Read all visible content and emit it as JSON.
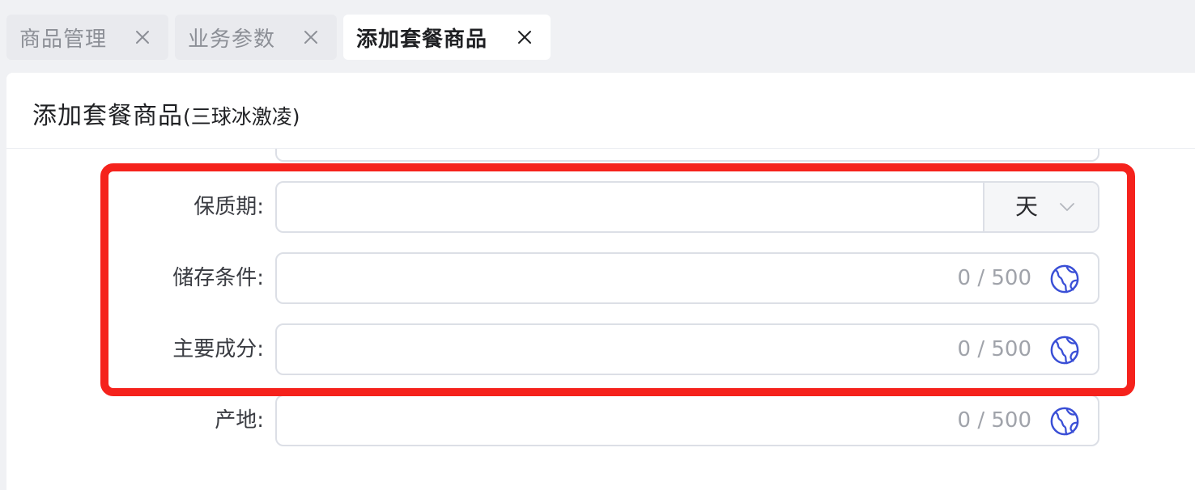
{
  "tabs": [
    {
      "label": "商品管理",
      "active": false
    },
    {
      "label": "业务参数",
      "active": false
    },
    {
      "label": "添加套餐商品",
      "active": true
    }
  ],
  "panel": {
    "title": "添加套餐商品",
    "subtitle": "(三球冰激凌)"
  },
  "form": {
    "shelf_life": {
      "label": "保质期:",
      "value": "",
      "unit": "天"
    },
    "storage": {
      "label": "储存条件:",
      "value": "",
      "counter": "0 / 500"
    },
    "ingredients": {
      "label": "主要成分:",
      "value": "",
      "counter": "0 / 500"
    },
    "origin": {
      "label": "产地:",
      "value": "",
      "counter": "0 / 500"
    }
  },
  "icons": {
    "tab_close": "close-icon",
    "unit_dropdown": "chevron-down-icon",
    "translate": "globe-icon"
  },
  "colors": {
    "page_bg": "#f0f1f4",
    "tab_bg": "#e9eaee",
    "active_tab_bg": "#ffffff",
    "border": "#dcdfe6",
    "counter_text": "#a0a3aa",
    "globe_icon": "#3a4fd6",
    "highlight": "#f5221c"
  }
}
